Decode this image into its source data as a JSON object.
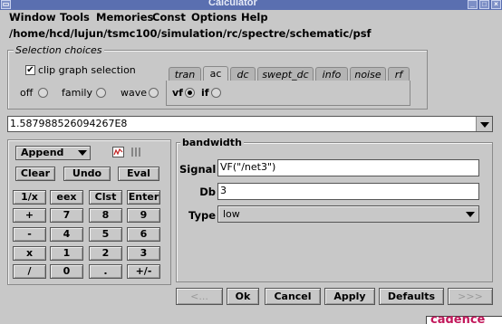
{
  "window": {
    "title": "Calculator"
  },
  "menu": [
    "Window",
    "Tools",
    "Memories",
    "Const",
    "Options",
    "Help"
  ],
  "path": "/home/hcd/lujun/tsmc100/simulation/rc/spectre/schematic/psf",
  "selection": {
    "title": "Selection choices",
    "clip_label": "clip graph selection",
    "clip_checked": true,
    "radios": [
      "off",
      "family",
      "wave"
    ],
    "tabs": [
      "tran",
      "ac",
      "dc",
      "swept_dc",
      "info",
      "noise",
      "rf"
    ],
    "active_tab": "ac",
    "ac_radios": [
      "vf",
      "if"
    ],
    "ac_selected": "vf"
  },
  "buffer": {
    "value": "1.587988526094267E8"
  },
  "stack_mode": "Append",
  "edit_buttons": [
    "Clear",
    "Undo",
    "Eval"
  ],
  "keypad": [
    [
      "1/x",
      "eex",
      "Clst",
      "Enter"
    ],
    [
      "+",
      "7",
      "8",
      "9"
    ],
    [
      "-",
      "4",
      "5",
      "6"
    ],
    [
      "x",
      "1",
      "2",
      "3"
    ],
    [
      "/",
      "0",
      ".",
      "+/-"
    ]
  ],
  "func": {
    "title": "bandwidth",
    "signal_label": "Signal",
    "signal_value": "VF(\"/net3\")",
    "db_label": "Db",
    "db_value": "3",
    "type_label": "Type",
    "type_value": "low"
  },
  "footer": {
    "prev": "<...",
    "ok": "Ok",
    "cancel": "Cancel",
    "apply": "Apply",
    "defaults": "Defaults",
    "next": ">>>"
  },
  "logo_partial": "cadence"
}
